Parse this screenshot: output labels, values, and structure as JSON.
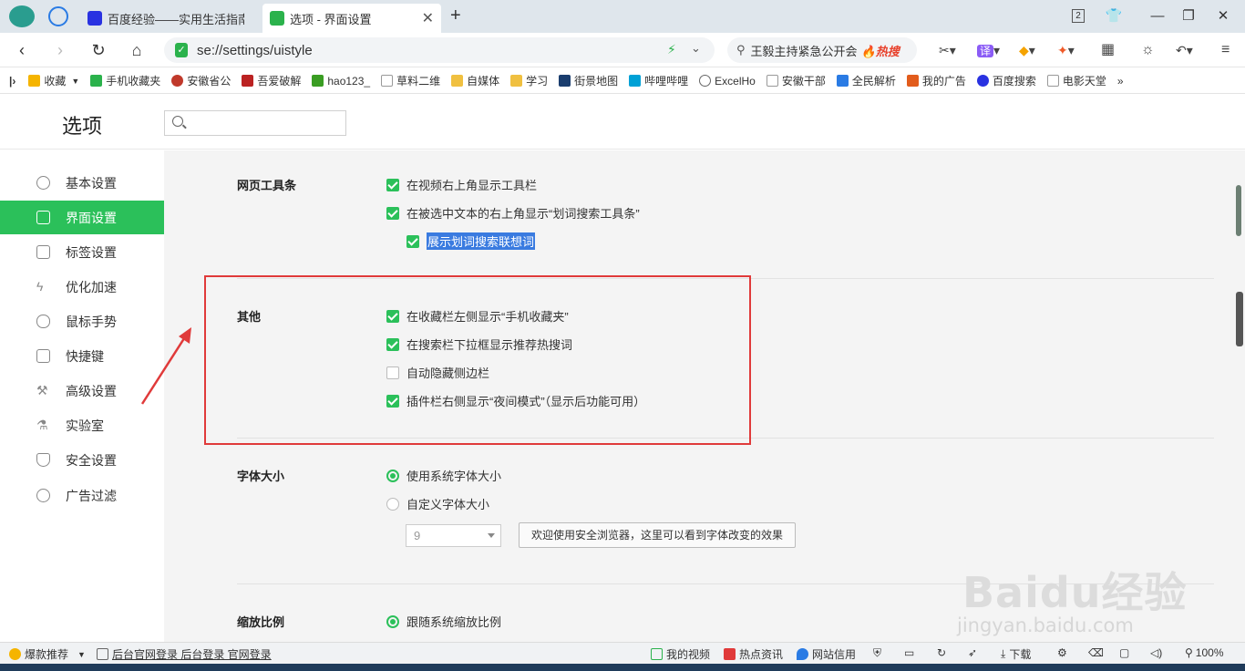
{
  "tabs": [
    {
      "label": "百度经验——实用生活指南",
      "active": false
    },
    {
      "label": "选项 - 界面设置",
      "active": true
    }
  ],
  "window": {
    "tab_count_badge": "2"
  },
  "navbar": {
    "url": "se://settings/uistyle",
    "search_text": "王毅主持紧急公开会",
    "search_hot": "🔥热搜"
  },
  "bookmarks": [
    {
      "label": "收藏",
      "icon": "star-icon",
      "color": "#f5b400"
    },
    {
      "label": "手机收藏夹",
      "icon": "phone-icon",
      "color": "#2bb24c"
    },
    {
      "label": "安徽省公",
      "icon": "emblem-icon",
      "color": "#c0392b"
    },
    {
      "label": "吾爱破解",
      "icon": "site-icon",
      "color": "#b22"
    },
    {
      "label": "hao123_",
      "icon": "hao123-icon",
      "color": "#3a9d23"
    },
    {
      "label": "草料二维",
      "icon": "page-icon",
      "color": "#999"
    },
    {
      "label": "自媒体",
      "icon": "folder-icon",
      "color": "#f0c040"
    },
    {
      "label": "学习",
      "icon": "folder-icon",
      "color": "#f0c040"
    },
    {
      "label": "街景地图",
      "icon": "map-icon",
      "color": "#1a3d6e"
    },
    {
      "label": "哔哩哔哩",
      "icon": "bilibili-icon",
      "color": "#00a1d6"
    },
    {
      "label": "ExcelHo",
      "icon": "excel-icon",
      "color": "#666"
    },
    {
      "label": "安徽干部",
      "icon": "page-icon",
      "color": "#999"
    },
    {
      "label": "全民解析",
      "icon": "play-icon",
      "color": "#2a7be4"
    },
    {
      "label": "我的广告",
      "icon": "ad-icon",
      "color": "#e25c1c"
    },
    {
      "label": "百度搜索",
      "icon": "baidu-icon",
      "color": "#2932e1"
    },
    {
      "label": "电影天堂",
      "icon": "page-icon",
      "color": "#999"
    },
    {
      "label": "»",
      "icon": "more-icon",
      "color": "#666"
    }
  ],
  "page": {
    "title": "选项",
    "search_placeholder": ""
  },
  "sidebar": {
    "items": [
      {
        "label": "基本设置",
        "icon": "gear-icon"
      },
      {
        "label": "界面设置",
        "icon": "window-icon",
        "active": true
      },
      {
        "label": "标签设置",
        "icon": "tab-icon"
      },
      {
        "label": "优化加速",
        "icon": "bolt-icon"
      },
      {
        "label": "鼠标手势",
        "icon": "mouse-icon"
      },
      {
        "label": "快捷键",
        "icon": "keyboard-icon"
      },
      {
        "label": "高级设置",
        "icon": "wrench-icon"
      },
      {
        "label": "实验室",
        "icon": "flask-icon"
      },
      {
        "label": "安全设置",
        "icon": "shield-icon"
      },
      {
        "label": "广告过滤",
        "icon": "block-icon"
      }
    ]
  },
  "sections": {
    "toolbar": {
      "title": "网页工具条",
      "options": [
        {
          "label": "在视频右上角显示工具栏",
          "checked": true
        },
        {
          "label": "在被选中文本的右上角显示“划词搜索工具条”",
          "checked": true
        },
        {
          "label": "展示划词搜索联想词",
          "checked": true
        }
      ]
    },
    "other": {
      "title": "其他",
      "options": [
        {
          "label": "在收藏栏左侧显示“手机收藏夹”",
          "checked": true
        },
        {
          "label": "在搜索栏下拉框显示推荐热搜词",
          "checked": true
        },
        {
          "label": "自动隐藏侧边栏",
          "checked": false
        },
        {
          "label": "插件栏右侧显示“夜间模式”（显示后功能可用）",
          "checked": true
        }
      ]
    },
    "font": {
      "title": "字体大小",
      "options": [
        {
          "label": "使用系统字体大小",
          "selected": true
        },
        {
          "label": "自定义字体大小",
          "selected": false
        }
      ],
      "size_value": "9",
      "preview_text": "欢迎使用安全浏览器，这里可以看到字体改变的效果"
    },
    "zoom": {
      "title": "缩放比例",
      "options": [
        {
          "label": "跟随系统缩放比例",
          "selected": true
        }
      ]
    }
  },
  "watermark": {
    "brand": "Baidu经验",
    "sub": "jingyan.baidu.com"
  },
  "statusbar": {
    "left": [
      {
        "label": "爆款推荐",
        "icon": "star-icon"
      },
      {
        "label": "后台官网登录 后台登录 官网登录",
        "icon": "news-icon"
      }
    ],
    "right": [
      {
        "label": "我的视频",
        "icon": "video-icon"
      },
      {
        "label": "热点资讯",
        "icon": "news-icon"
      },
      {
        "label": "网站信用",
        "icon": "drop-icon"
      },
      {
        "label": "下载",
        "icon": "download-icon"
      },
      {
        "label": "100%",
        "icon": "zoom-icon"
      }
    ]
  },
  "colors": {
    "accent": "#2bc05a",
    "annotation": "#e03a3a",
    "selection": "#3a7be0"
  }
}
